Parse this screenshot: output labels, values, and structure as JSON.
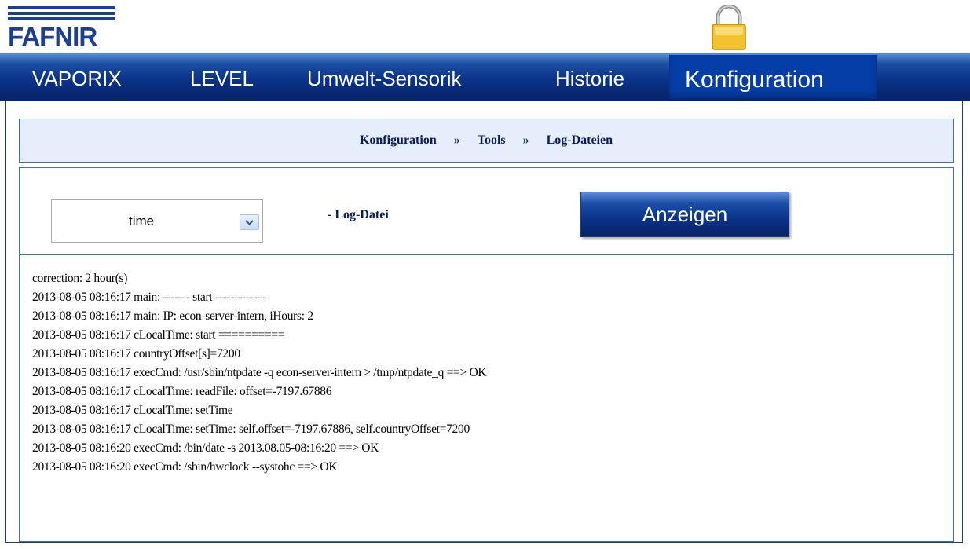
{
  "logo": {
    "text": "FAFNIR"
  },
  "nav": {
    "items": [
      {
        "label": "VAPORIX"
      },
      {
        "label": "LEVEL"
      },
      {
        "label": "Umwelt-Sensorik"
      },
      {
        "label": "Historie"
      },
      {
        "label": "Konfiguration"
      }
    ],
    "active": "Konfiguration"
  },
  "breadcrumb": {
    "items": [
      "Konfiguration",
      "Tools",
      "Log-Dateien"
    ],
    "separator": "»"
  },
  "controls": {
    "select_value": "time",
    "logfile_label": "- Log-Datei",
    "show_button": "Anzeigen"
  },
  "log": {
    "lines": [
      "correction: 2 hour(s)",
      "2013-08-05 08:16:17 main: ------- start -------------",
      "2013-08-05 08:16:17 main: IP: econ-server-intern, iHours: 2",
      "2013-08-05 08:16:17 cLocalTime: start ==========",
      "2013-08-05 08:16:17 countryOffset[s]=7200",
      "2013-08-05 08:16:17 execCmd: /usr/sbin/ntpdate -q econ-server-intern > /tmp/ntpdate_q ==> OK",
      "2013-08-05 08:16:17 cLocalTime: readFile: offset=-7197.67886",
      "2013-08-05 08:16:17 cLocalTime: setTime",
      "2013-08-05 08:16:17 cLocalTime: setTime: self.offset=-7197.67886, self.countryOffset=7200",
      "2013-08-05 08:16:20 execCmd: /bin/date -s 2013.08.05-08:16:20 ==> OK",
      "2013-08-05 08:16:20 execCmd: /sbin/hwclock --systohc ==> OK"
    ]
  },
  "colors": {
    "brand": "#1c3f94",
    "nav_active": "#063ea8",
    "breadcrumb_bg": "#e6eefb",
    "lock": "#f2c230"
  }
}
